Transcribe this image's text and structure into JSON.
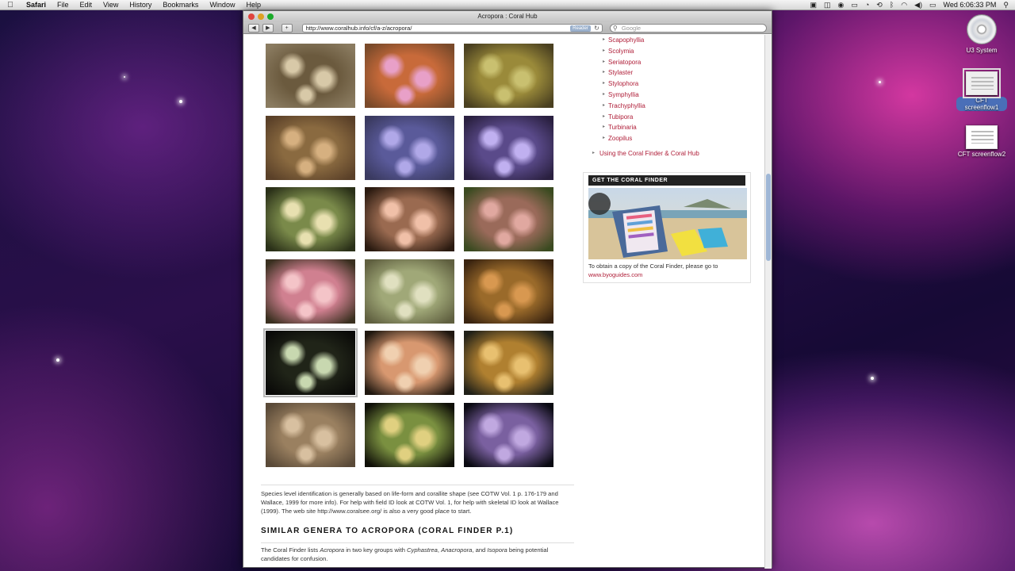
{
  "menubar": {
    "apple": "",
    "app_name": "Safari",
    "menus": [
      "File",
      "Edit",
      "View",
      "History",
      "Bookmarks",
      "Window",
      "Help"
    ],
    "clock": "Wed 6:06:33 PM"
  },
  "window": {
    "title": "Acropora : Coral Hub",
    "url": "http://www.coralhub.info/cf/a-z/acropora/",
    "reader_label": "Reader",
    "search_placeholder": "Google"
  },
  "thumbnails": [
    {
      "colors": [
        "#6b5a3e",
        "#d8c9a8",
        "#8a7b60"
      ]
    },
    {
      "colors": [
        "#c86a3a",
        "#e8a0c8",
        "#7a4a2a"
      ]
    },
    {
      "colors": [
        "#9a8a3a",
        "#c9c070",
        "#4a4020"
      ]
    },
    {
      "colors": [
        "#8a6a40",
        "#d6b080",
        "#5a4028"
      ]
    },
    {
      "colors": [
        "#5a5a9a",
        "#b0a8e8",
        "#3a3a60"
      ]
    },
    {
      "colors": [
        "#5a4a8a",
        "#c0b0f0",
        "#2a2040"
      ]
    },
    {
      "colors": [
        "#7a8a4a",
        "#e8e0b0",
        "#2a3018"
      ]
    },
    {
      "colors": [
        "#9a6a50",
        "#f0c0a8",
        "#2a1a10"
      ]
    },
    {
      "colors": [
        "#9a6a5a",
        "#e0a8a0",
        "#3a4a20"
      ]
    },
    {
      "colors": [
        "#d08090",
        "#f4c4c8",
        "#3a3020"
      ]
    },
    {
      "colors": [
        "#a0a878",
        "#e0e0c0",
        "#606040"
      ]
    },
    {
      "colors": [
        "#9a6a2a",
        "#d89850",
        "#3a2410"
      ]
    },
    {
      "colors": [
        "#202418",
        "#c8d8b0",
        "#0a0a08"
      ]
    },
    {
      "colors": [
        "#d89870",
        "#f0d0b0",
        "#201810"
      ]
    },
    {
      "colors": [
        "#b08030",
        "#e8c070",
        "#202018"
      ]
    },
    {
      "colors": [
        "#9a8060",
        "#d8c0a0",
        "#5a4a38"
      ]
    },
    {
      "colors": [
        "#7a9040",
        "#e0d080",
        "#101008"
      ]
    },
    {
      "colors": [
        "#7a60a0",
        "#c0a8e0",
        "#0a0a12"
      ]
    }
  ],
  "selected_thumbnail_index": 12,
  "genera": [
    "Scapophyllia",
    "Scolymia",
    "Seriatopora",
    "Stylaster",
    "Stylophora",
    "Symphyllia",
    "Trachyphyllia",
    "Tubipora",
    "Turbinaria",
    "Zoopilus"
  ],
  "using_link": "Using the Coral Finder & Coral Hub",
  "coral_finder": {
    "header": "GET THE CORAL FINDER",
    "text": "To obtain a copy of the Coral Finder, please go to",
    "link": "www.byoguides.com"
  },
  "body": {
    "species_text": "Species level identification is generally based on life-form and corallite shape (see COTW Vol. 1 p. 176-179 and Wallace, 1999 for more info).  For help with field ID look at COTW Vol. 1, for help with skeletal ID look at Wallace (1999). The web site http://www.coralsee.org/ is also a very good place to start.",
    "heading": "SIMILAR GENERA TO ACROPORA (CORAL FINDER P.1)",
    "confusion_text_prefix": "The Coral Finder lists ",
    "confusion_em1": "Acropora",
    "confusion_mid1": " in two key groups with ",
    "confusion_em2": "Cyphastrea",
    "confusion_sep": ", ",
    "confusion_em3": "Anacropora",
    "confusion_mid2": ", and ",
    "confusion_em4": "Isopora",
    "confusion_suffix": " being potential candidates for confusion."
  },
  "desktop": {
    "disc_label": "U3 System",
    "file1_label": "CFT screenflow1",
    "file2_label": "CFT screenflow2"
  }
}
